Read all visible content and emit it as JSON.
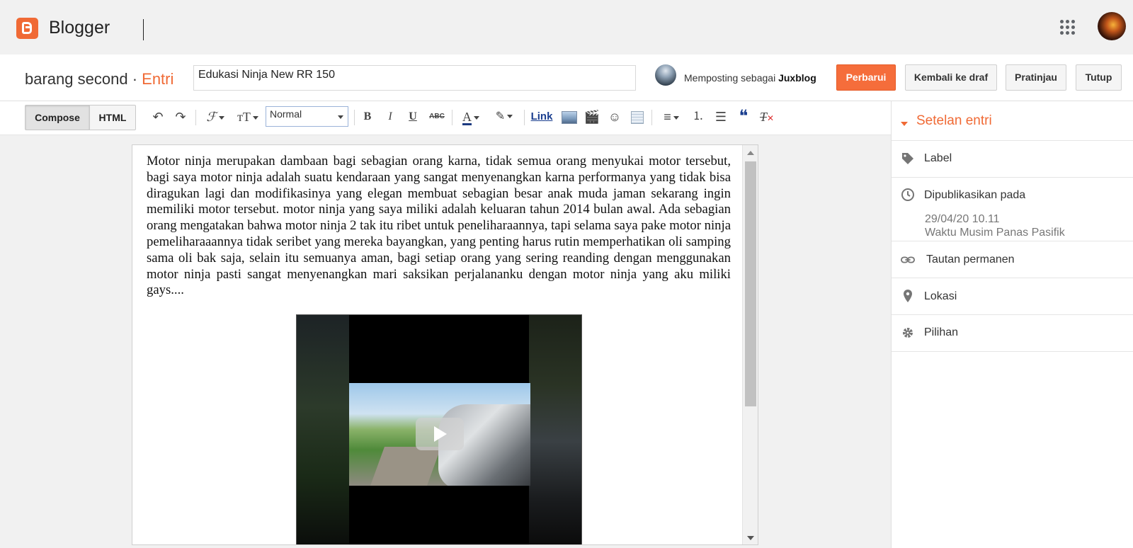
{
  "app": {
    "name": "Blogger"
  },
  "entry": {
    "blog_name": "barang second",
    "separator": "·",
    "section": "Entri",
    "title_value": "Edukasi Ninja New RR 150",
    "posting_as_prefix": "Memposting sebagai",
    "posting_as_user": "Juxblog"
  },
  "actions": {
    "update": "Perbarui",
    "revert_draft": "Kembali ke draf",
    "preview": "Pratinjau",
    "close": "Tutup"
  },
  "toolbar": {
    "compose": "Compose",
    "html": "HTML",
    "format_value": "Normal",
    "link": "Link",
    "bold": "B",
    "italic": "I",
    "underline": "U",
    "strike": "ABC"
  },
  "editor": {
    "body": "Motor ninja merupakan dambaan bagi sebagian orang karna, tidak semua orang menyukai motor tersebut, bagi saya motor ninja adalah suatu kendaraan yang sangat menyenangkan karna performanya yang tidak bisa diragukan lagi dan modifikasinya yang elegan membuat sebagian besar anak muda jaman sekarang ingin memiliki motor tersebut. motor ninja yang saya miliki adalah keluaran tahun 2014 bulan awal. Ada sebagian orang mengatakan bahwa motor ninja 2 tak itu ribet untuk peneliharaannya, tapi selama saya pake motor ninja pemeliharaaannya tidak seribet yang mereka bayangkan, yang penting harus rutin memperhatikan oli samping sama oli bak saja, selain itu semuanya aman, bagi setiap orang yang sering reanding dengan menggunakan motor ninja pasti sangat menyenangkan mari saksikan perjalananku dengan motor ninja yang aku miliki gays...."
  },
  "sidebar": {
    "heading": "Setelan entri",
    "items": [
      {
        "label": "Label",
        "icon": "tag-icon"
      },
      {
        "label": "Dipublikasikan pada",
        "icon": "clock-icon",
        "sub1": "29/04/20 10.11",
        "sub2": "Waktu Musim Panas Pasifik"
      },
      {
        "label": "Tautan permanen",
        "icon": "link-icon"
      },
      {
        "label": "Lokasi",
        "icon": "location-pin-icon"
      },
      {
        "label": "Pilihan",
        "icon": "gear-icon"
      }
    ]
  },
  "colors": {
    "brand": "#f06a35",
    "primary_button": "#f56d3b"
  }
}
